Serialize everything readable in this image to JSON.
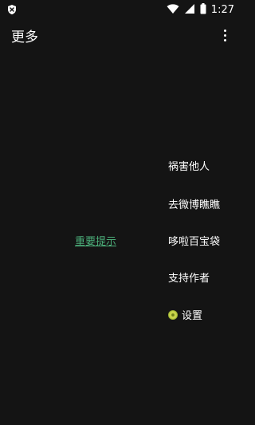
{
  "status_bar": {
    "time": "1:27",
    "left_icon": "shield-x-icon",
    "icons": [
      "wifi-icon",
      "signal-icon",
      "battery-icon"
    ]
  },
  "app_bar": {
    "title": "更多",
    "overflow_icon": "more-vertical-icon"
  },
  "main": {
    "notice_link": "重要提示",
    "notice_color": "#4caf7a"
  },
  "menu": {
    "items": [
      {
        "label": "祸害他人"
      },
      {
        "label": "去微博瞧瞧"
      },
      {
        "label": "哆啦百宝袋"
      },
      {
        "label": "支持作者"
      },
      {
        "label": "设置",
        "icon": "settings-coin-icon"
      }
    ]
  },
  "colors": {
    "background": "#141414",
    "text": "#ffffff",
    "accent": "#4caf7a"
  }
}
